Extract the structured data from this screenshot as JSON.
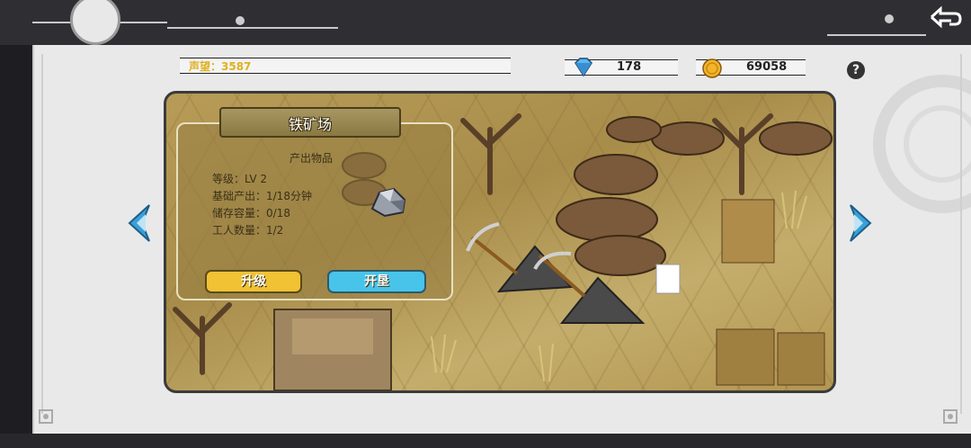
{
  "screen": {
    "building_name": "铁矿场",
    "produced_items_label": "产出物品",
    "stats": {
      "level": "等级：LV 2",
      "base_output": "基础产出：1/18分钟",
      "storage": "储存容量：0/18",
      "workers": "工人数量：1/2"
    },
    "buttons": {
      "upgrade": "升级",
      "develop": "开垦"
    }
  },
  "resources": {
    "prestige": "声望：3587",
    "diamonds": "178",
    "gold": "69058"
  },
  "icons": {
    "help": "?",
    "back": "back-arrow-icon",
    "diamond": "diamond-icon",
    "coin": "coin-icon",
    "ore": "iron-ore-icon"
  },
  "colors": {
    "upgrade_button": "#f0c234",
    "develop_button": "#48c4ea",
    "nav_arrow": "#3aa0d8"
  }
}
